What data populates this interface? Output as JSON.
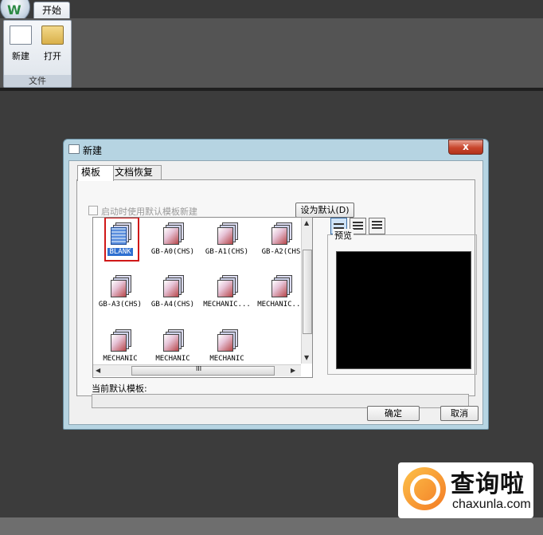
{
  "ribbon": {
    "tab_start": "开始",
    "new_label": "新建",
    "open_label": "打开",
    "group_label": "文件"
  },
  "dialog": {
    "title": "新建",
    "close_symbol": "x",
    "tabs": [
      "模板",
      "文档恢复"
    ],
    "startup_checkbox_label": "启动时使用默认模板新建",
    "set_default_button": "设为默认(D)",
    "preview_label": "预览",
    "current_default_label": "当前默认模板:",
    "ok_button": "确定",
    "cancel_button": "取消",
    "templates": [
      "BLANK",
      "GB-A0(CHS)",
      "GB-A1(CHS)",
      "GB-A2(CHS",
      "GB-A3(CHS)",
      "GB-A4(CHS)",
      "MECHANIC...",
      "MECHANIC...",
      "MECHANIC",
      "MECHANIC",
      "MECHANIC"
    ],
    "selected_template": "BLANK",
    "hscroll_grip": "III"
  },
  "watermark": {
    "cn": "查询啦",
    "en": "chaxunla.com"
  }
}
